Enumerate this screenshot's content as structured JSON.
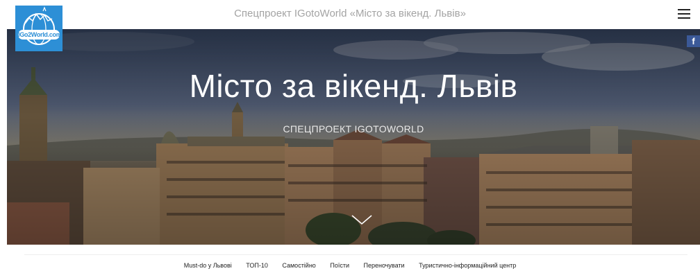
{
  "header": {
    "logo_text": "IGo2World.com",
    "title": "Спецпроект IGotoWorld «Місто за вікенд. Львів»",
    "menu_icon": "hamburger-menu-icon"
  },
  "hero": {
    "title": "Місто за вікенд. Львів",
    "subtitle": "СПЕЦПРОЕКТ IGOTOWORLD",
    "scroll_icon": "chevron-down-icon"
  },
  "social": {
    "facebook_label": "f",
    "facebook_icon": "facebook-icon"
  },
  "nav": {
    "items": [
      {
        "label": "Must-do у Львові"
      },
      {
        "label": "ТОП-10"
      },
      {
        "label": "Самостійно"
      },
      {
        "label": "Поїсти"
      },
      {
        "label": "Переночувати"
      },
      {
        "label": "Туристично-інформаційний центр"
      }
    ]
  },
  "colors": {
    "logo_bg": "#2d8fd6",
    "facebook_bg": "#3b5998",
    "header_text": "#a3a3a3"
  }
}
